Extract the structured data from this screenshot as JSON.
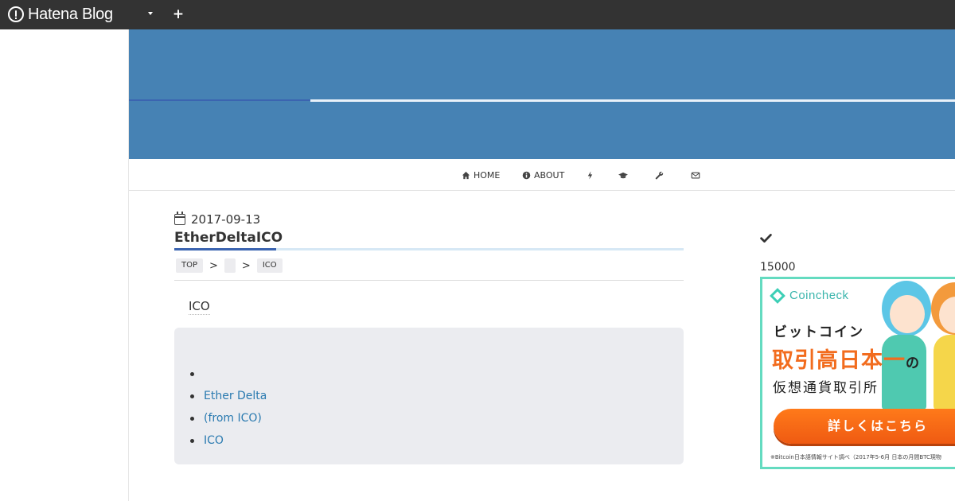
{
  "topbar": {
    "logo_text": "Hatena Blog",
    "add_symbol": "+"
  },
  "colors": {
    "topbar_bg": "#333333",
    "header_band": "#4682b4",
    "accent_blue": "#3b64b0",
    "link": "#2a7ab0",
    "ad_orange": "#f26c1e",
    "ad_border": "#64dbc0"
  },
  "nav": {
    "items": [
      {
        "icon": "home-icon",
        "label": "HOME"
      },
      {
        "icon": "info-icon",
        "label": "ABOUT"
      },
      {
        "icon": "bolt-icon",
        "label": ""
      },
      {
        "icon": "graduation-cap-icon",
        "label": ""
      },
      {
        "icon": "wrench-icon",
        "label": ""
      },
      {
        "icon": "envelope-icon",
        "label": ""
      }
    ]
  },
  "article": {
    "date": "2017-09-13",
    "title": "EtherDeltaICO",
    "breadcrumb": {
      "top": "TOP",
      "middle": "",
      "last": "ICO",
      "separator": ">"
    },
    "lead": "ICO",
    "list": [
      "",
      "Ether Delta",
      "(from ICO)",
      "ICO"
    ]
  },
  "sidebar": {
    "count_text": "15000",
    "ad": {
      "brand": "Coincheck",
      "line1": "ビットコイン",
      "line2": "取引高日本一",
      "line2_suffix": "の",
      "line3": "仮想通貨取引所",
      "button": "詳しくはこちら",
      "footnote": "※Bitcoin日本語情報サイト調べ（2017年5-6月 日本の月間BTC現物"
    }
  }
}
